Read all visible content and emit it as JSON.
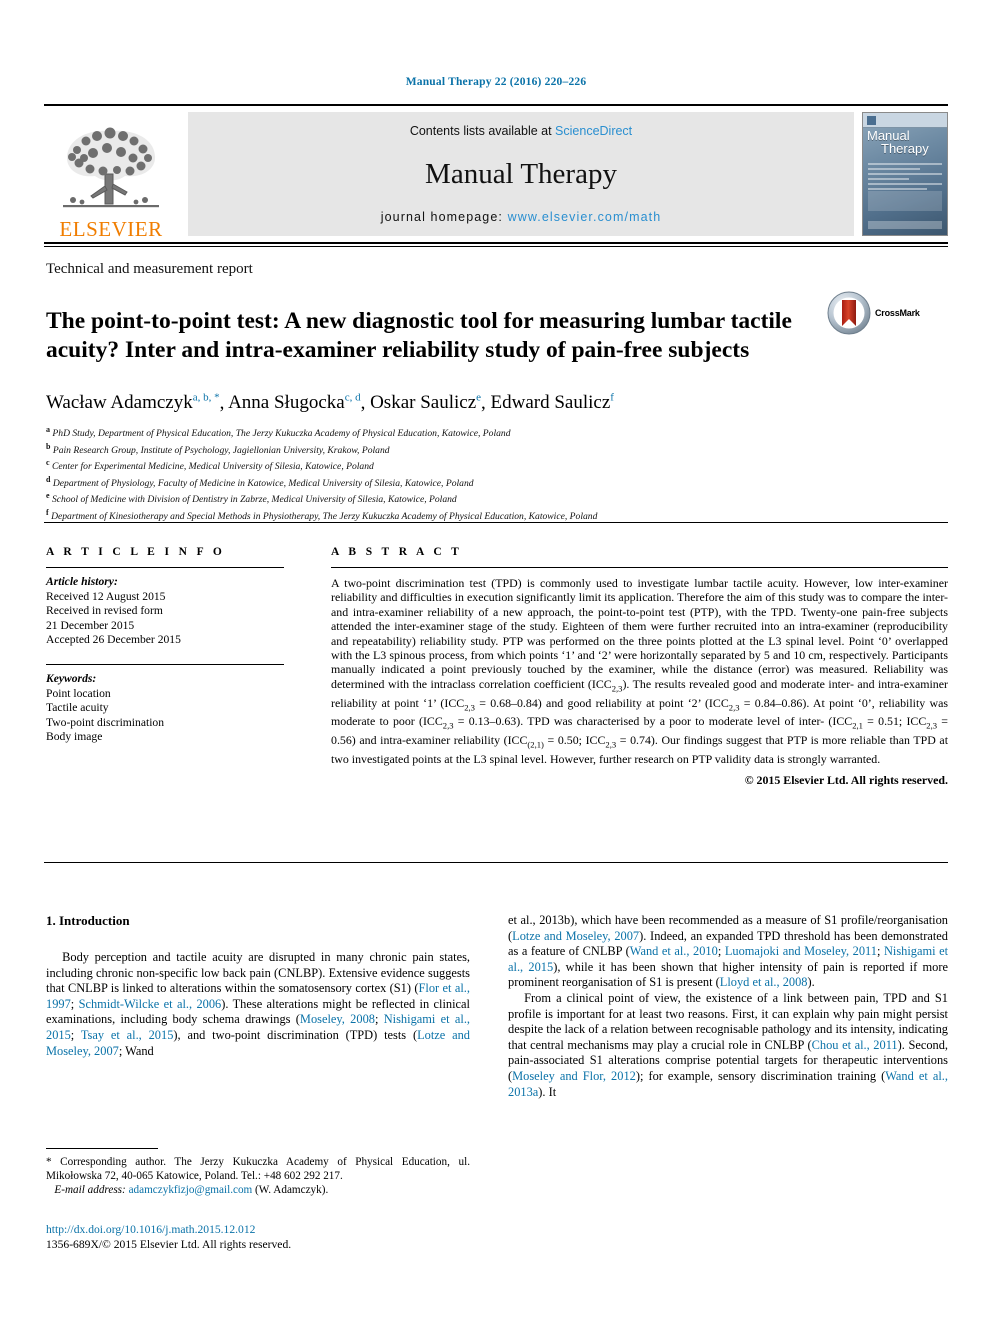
{
  "running_head": "Manual Therapy 22 (2016) 220–226",
  "masthead": {
    "contents_prefix": "Contents lists available at ",
    "contents_link": "ScienceDirect",
    "journal_name": "Manual Therapy",
    "homepage_prefix": "journal homepage: ",
    "homepage_url": "www.elsevier.com/math",
    "publisher": "ELSEVIER",
    "cover_title_line1": "Manual",
    "cover_title_line2": "Therapy"
  },
  "article_type": "Technical and measurement report",
  "title": "The point-to-point test: A new diagnostic tool for measuring lumbar tactile acuity? Inter and intra-examiner reliability study of pain-free subjects",
  "crossmark_label": "CrossMark",
  "authors": [
    {
      "name": "Wacław Adamczyk",
      "marks": "a, b, *"
    },
    {
      "name": "Anna Sługocka",
      "marks": "c, d"
    },
    {
      "name": "Oskar Saulicz",
      "marks": "e"
    },
    {
      "name": "Edward Saulicz",
      "marks": "f"
    }
  ],
  "affiliations": [
    {
      "mark": "a",
      "text": "PhD Study, Department of Physical Education, The Jerzy Kukuczka Academy of Physical Education, Katowice, Poland"
    },
    {
      "mark": "b",
      "text": "Pain Research Group, Institute of Psychology, Jagiellonian University, Krakow, Poland"
    },
    {
      "mark": "c",
      "text": "Center for Experimental Medicine, Medical University of Silesia, Katowice, Poland"
    },
    {
      "mark": "d",
      "text": "Department of Physiology, Faculty of Medicine in Katowice, Medical University of Silesia, Katowice, Poland"
    },
    {
      "mark": "e",
      "text": "School of Medicine with Division of Dentistry in Zabrze, Medical University of Silesia, Katowice, Poland"
    },
    {
      "mark": "f",
      "text": "Department of Kinesiotherapy and Special Methods in Physiotherapy, The Jerzy Kukuczka Academy of Physical Education, Katowice, Poland"
    }
  ],
  "article_info": {
    "heading": "A R T I C L E   I N F O",
    "history_label": "Article history:",
    "history": [
      "Received 12 August 2015",
      "Received in revised form",
      "21 December 2015",
      "Accepted 26 December 2015"
    ],
    "keywords_label": "Keywords:",
    "keywords": [
      "Point location",
      "Tactile acuity",
      "Two-point discrimination",
      "Body image"
    ]
  },
  "abstract": {
    "heading": "A B S T R A C T",
    "text": "A two-point discrimination test (TPD) is commonly used to investigate lumbar tactile acuity. However, low inter-examiner reliability and difficulties in execution significantly limit its application. Therefore the aim of this study was to compare the inter- and intra-examiner reliability of a new approach, the point-to-point test (PTP), with the TPD. Twenty-one pain-free subjects attended the inter-examiner stage of the study. Eighteen of them were further recruited into an intra-examiner (reproducibility and repeatability) reliability study. PTP was performed on the three points plotted at the L3 spinal level. Point ‘0’ overlapped with the L3 spinous process, from which points ‘1’ and ‘2’ were horizontally separated by 5 and 10 cm, respectively. Participants manually indicated a point previously touched by the examiner, while the distance (error) was measured. Reliability was determined with the intraclass correlation coefficient (ICC2,3). The results revealed good and moderate inter- and intra-examiner reliability at point ‘1’ (ICC2,3 = 0.68–0.84) and good reliability at point ‘2’ (ICC2,3 = 0.84–0.86). At point ‘0’, reliability was moderate to poor (ICC2,3 = 0.13–0.63). TPD was characterised by a poor to moderate level of inter- (ICC2,1 = 0.51; ICC2,3 = 0.56) and intra-examiner reliability (ICC(2,1) = 0.50; ICC2,3 = 0.74). Our findings suggest that PTP is more reliable than TPD at two investigated points at the L3 spinal level. However, further research on PTP validity data is strongly warranted.",
    "copyright": "© 2015 Elsevier Ltd. All rights reserved."
  },
  "section": {
    "number_title": "1. Introduction",
    "left_paragraph": "Body perception and tactile acuity are disrupted in many chronic pain states, including chronic non-specific low back pain (CNLBP). Extensive evidence suggests that CNLBP is linked to alterations within the somatosensory cortex (S1) (Flor et al., 1997; Schmidt-Wilcke et al., 2006). These alterations might be reflected in clinical examinations, including body schema drawings (Moseley, 2008; Nishigami et al., 2015; Tsay et al., 2015), and two-point discrimination (TPD) tests (Lotze and Moseley, 2007; Wand",
    "right_paragraph_1": "et al., 2013b), which have been recommended as a measure of S1 profile/reorganisation (Lotze and Moseley, 2007). Indeed, an expanded TPD threshold has been demonstrated as a feature of CNLBP (Wand et al., 2010; Luomajoki and Moseley, 2011; Nishigami et al., 2015), while it has been shown that higher intensity of pain is reported if more prominent reorganisation of S1 is present (Lloyd et al., 2008).",
    "right_paragraph_2": "From a clinical point of view, the existence of a link between pain, TPD and S1 profile is important for at least two reasons. First, it can explain why pain might persist despite the lack of a relation between recognisable pathology and its intensity, indicating that central mechanisms may play a crucial role in CNLBP (Chou et al., 2011). Second, pain-associated S1 alterations comprise potential targets for therapeutic interventions (Moseley and Flor, 2012); for example, sensory discrimination training (Wand et al., 2013a). It"
  },
  "footnote": {
    "corresponding": "* Corresponding author. The Jerzy Kukuczka Academy of Physical Education, ul. Mikołowska 72, 40-065 Katowice, Poland. Tel.: +48 602 292 217.",
    "email_label": "E-mail address:",
    "email": "adamczykfizjo@gmail.com",
    "email_suffix": "(W. Adamczyk)."
  },
  "doi_block": {
    "doi": "http://dx.doi.org/10.1016/j.math.2015.12.012",
    "issn_line": "1356-689X/© 2015 Elsevier Ltd. All rights reserved."
  },
  "colors": {
    "link_blue": "#0a72a8",
    "sd_blue": "#2a8fd0",
    "elsevier_orange": "#f07d00"
  }
}
